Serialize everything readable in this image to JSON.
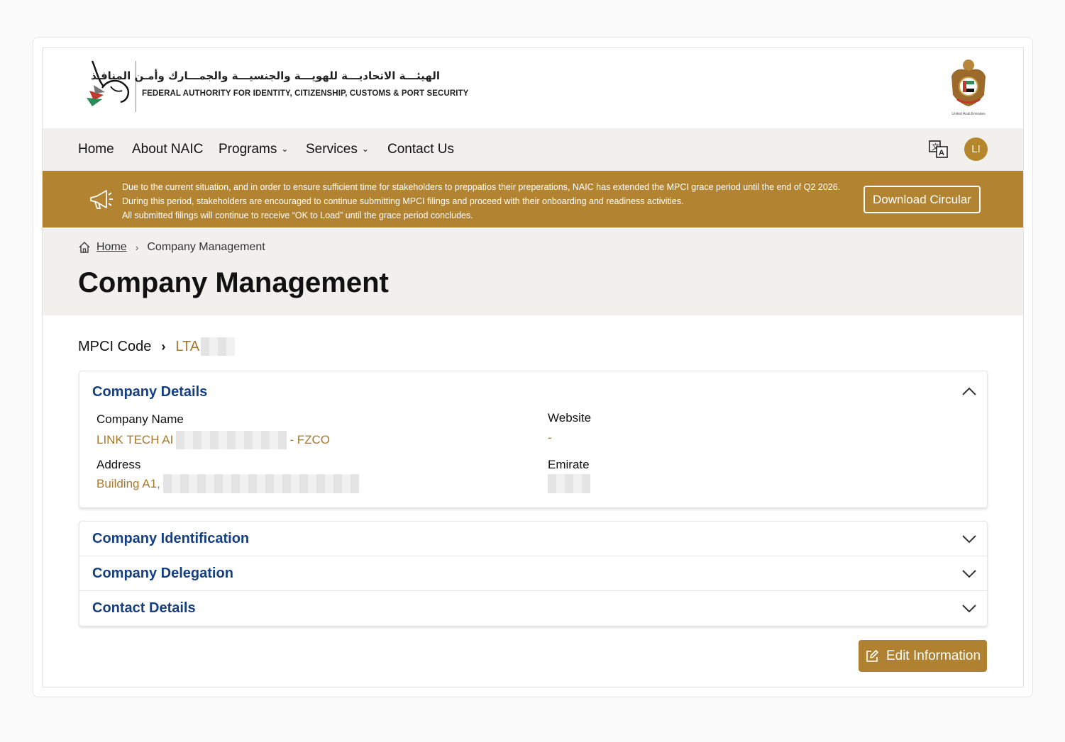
{
  "header": {
    "logo_ar": "الهيئـــة الاتحاديـــة للهويـــة والجنسيـــة والجمـــارك وأمـن المنافـذ",
    "logo_en": "FEDERAL AUTHORITY FOR IDENTITY, CITIZENSHIP, CUSTOMS & PORT SECURITY",
    "emblem_caption": "United Arab Emirates"
  },
  "nav": {
    "items": [
      {
        "label": "Home",
        "has_dropdown": false
      },
      {
        "label": "About NAIC",
        "has_dropdown": false
      },
      {
        "label": "Programs",
        "has_dropdown": true
      },
      {
        "label": "Services",
        "has_dropdown": true
      },
      {
        "label": "Contact Us",
        "has_dropdown": false
      }
    ],
    "language_icon": "translate-icon",
    "avatar_initials": "LI"
  },
  "banner": {
    "lines": [
      "Due to the current situation, and in order to ensure sufficient time for stakeholders to preppatios their preperations, NAIC has extended the MPCI grace period until the end of Q2 2026.",
      "During this period, stakeholders are encouraged to continue submitting MPCI filings and proceed with their onboarding and readiness activities.",
      "All submitted filings will continue to receive “OK to Load” until the grace period concludes."
    ],
    "icon": "megaphone-icon",
    "button_label": "Download Circular"
  },
  "breadcrumb": {
    "home": "Home",
    "current": "Company Management"
  },
  "page_title": "Company Management",
  "mpci": {
    "label": "MPCI Code",
    "code_prefix": "LTA"
  },
  "company_details": {
    "title": "Company Details",
    "expanded": true,
    "fields": {
      "company_name_label": "Company Name",
      "company_name_prefix": "LINK TECH AI",
      "company_name_suffix": "- FZCO",
      "website_label": "Website",
      "website_value": "-",
      "address_label": "Address",
      "address_prefix": "Building A1,",
      "emirate_label": "Emirate"
    }
  },
  "accordions": [
    {
      "title": "Company Identification",
      "expanded": false
    },
    {
      "title": "Company Delegation",
      "expanded": false
    },
    {
      "title": "Contact Details",
      "expanded": false
    }
  ],
  "edit_button_label": "Edit Information",
  "colors": {
    "gold": "#b28331",
    "link_gold": "#a8782a",
    "title_blue": "#163f82",
    "nav_bg": "#f1f0ed"
  }
}
